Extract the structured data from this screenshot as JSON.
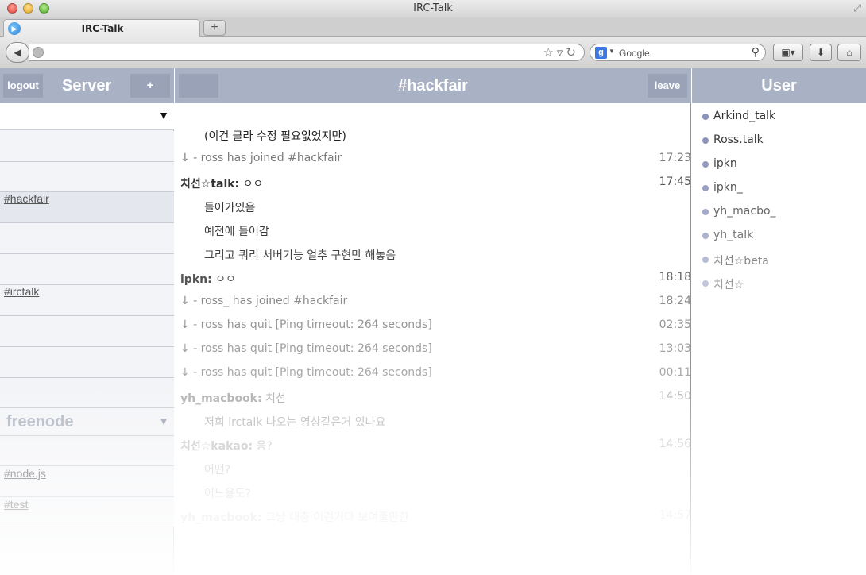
{
  "window": {
    "title": "IRC-Talk"
  },
  "tab": {
    "label": "IRC-Talk",
    "new_tab": "+"
  },
  "search": {
    "engine": "Google"
  },
  "left": {
    "logout": "logout",
    "title": "Server",
    "add": "+",
    "servers": [
      {
        "name": "",
        "arrow": "▼"
      },
      {
        "name": "freenode",
        "arrow": "▼"
      }
    ],
    "channels": [
      "#hackfair",
      "#irctalk",
      "#node.js",
      "#test"
    ]
  },
  "center": {
    "channel": "#hackfair",
    "leave": "leave",
    "messages": [
      {
        "nick": "",
        "text": "(이건 클라 수정 필요없었지만)",
        "time": ""
      },
      {
        "nick": "",
        "text": "↓ - ross has joined #hackfair",
        "time": "17:23"
      },
      {
        "nick": "치선☆talk:",
        "text": "ㅇㅇ",
        "time": "17:45"
      },
      {
        "nick": "",
        "text": "들어가있음",
        "time": ""
      },
      {
        "nick": "",
        "text": "예전에 들어감",
        "time": ""
      },
      {
        "nick": "",
        "text": "그리고 쿼리 서버기능 얼추 구현만 해놓음",
        "time": ""
      },
      {
        "nick": "ipkn:",
        "text": "ㅇㅇ",
        "time": "18:18"
      },
      {
        "nick": "",
        "text": "↓ - ross_ has joined #hackfair",
        "time": "18:24"
      },
      {
        "nick": "",
        "text": "↓ - ross has quit [Ping timeout: 264 seconds]",
        "time": "02:35"
      },
      {
        "nick": "",
        "text": "↓ - ross has quit [Ping timeout: 264 seconds]",
        "time": "13:03"
      },
      {
        "nick": "",
        "text": "↓ - ross has quit [Ping timeout: 264 seconds]",
        "time": "00:11"
      },
      {
        "nick": "yh_macbook:",
        "text": "치선",
        "time": "14:50"
      },
      {
        "nick": "",
        "text": "저희 irctalk 나오는 영상같은거 있나요",
        "time": ""
      },
      {
        "nick": "치선☆kakao:",
        "text": "응?",
        "time": "14:56"
      },
      {
        "nick": "",
        "text": "어떤?",
        "time": ""
      },
      {
        "nick": "",
        "text": "어느용도?",
        "time": ""
      },
      {
        "nick": "yh_macbook:",
        "text": "그냥 대충 이런거다 보여줄만한",
        "time": "14:57"
      }
    ]
  },
  "right": {
    "title": "User",
    "users": [
      "Arkind_talk",
      "Ross.talk",
      "ipkn",
      "ipkn_",
      "yh_macbo_",
      "yh_talk",
      "치선☆beta",
      "치선☆"
    ]
  },
  "colors": {
    "header": "#a9b1c5",
    "header_button": "#9aa2b7",
    "user_dot": "#8c93bb"
  }
}
